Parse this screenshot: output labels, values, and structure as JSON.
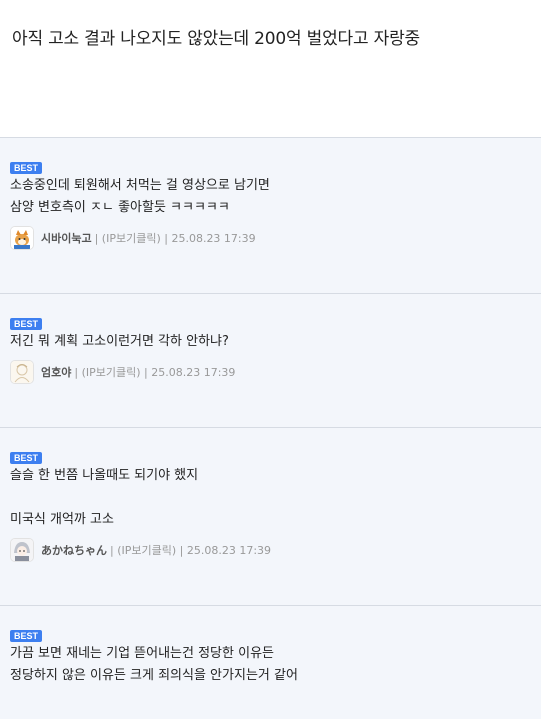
{
  "post": {
    "headline": "아직 고소 결과 나오지도 않았는데  200억 벌었다고 자랑중"
  },
  "comments": [
    {
      "badge": "BEST",
      "lines": [
        "소송중인데 퇴원해서 처먹는 걸 영상으로 남기면",
        "삼양 변호측이 ㅈㄴ 좋아할듯 ㅋㅋㅋㅋㅋ"
      ],
      "nickname": "시바이눅고",
      "meta": "| (IP보기클릭) | 25.08.23 17:39",
      "avatar_icon": "shiba-avatar-icon"
    },
    {
      "badge": "BEST",
      "lines": [
        "저긴 뭐 계획 고소이런거면 각하 안하냐?"
      ],
      "nickname": "엄호야",
      "meta": "| (IP보기클릭) | 25.08.23 17:39",
      "avatar_icon": "sketch-avatar-icon"
    },
    {
      "badge": "BEST",
      "lines": [
        "슬슬 한 번쯤 나올때도 되기야 했지",
        "",
        "미국식 개억까 고소"
      ],
      "nickname": "あかねちゃん",
      "meta": "| (IP보기클릭) | 25.08.23 17:39",
      "avatar_icon": "anime-avatar-icon"
    },
    {
      "badge": "BEST",
      "lines": [
        "가끔 보면 재네는 기업 뜯어내는건 정당한 이유든",
        "정당하지 않은 이유든 크게 죄의식을 안가지는거 같어"
      ]
    }
  ]
}
